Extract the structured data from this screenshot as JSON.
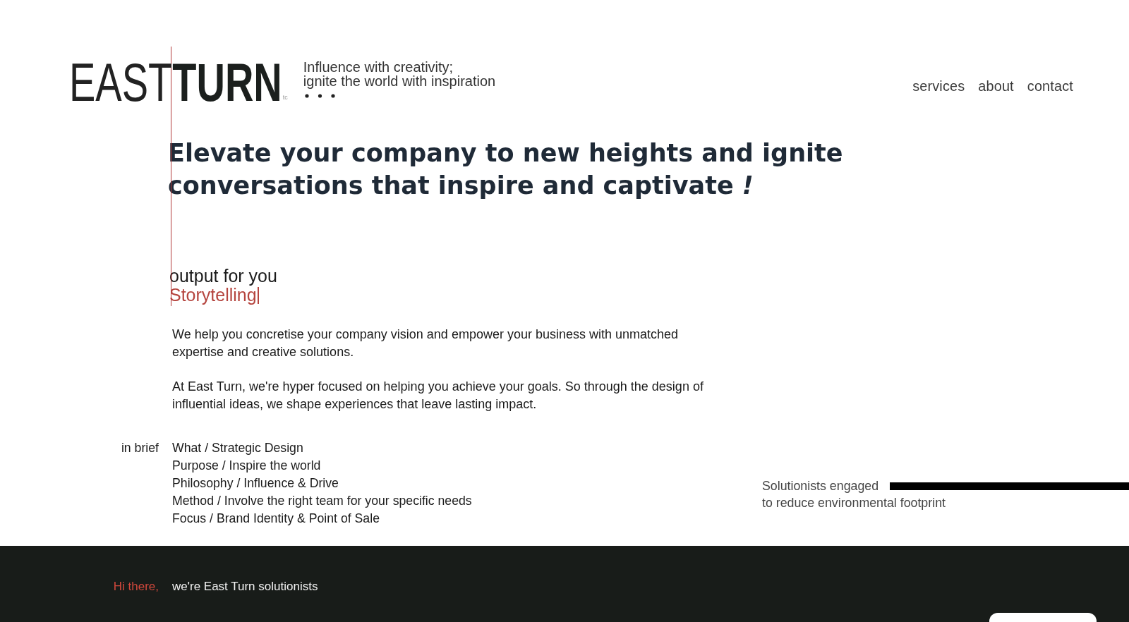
{
  "logo": {
    "light_word": "EAST",
    "bold_word": "TURN",
    "suffix": "tc"
  },
  "tagline": [
    "Influence with creativity;",
    "ignite the world with inspiration"
  ],
  "nav": [
    {
      "label": "services"
    },
    {
      "label": "about"
    },
    {
      "label": "contact"
    }
  ],
  "headline": "Elevate your company to new heights and ignite conversations that inspire and captivate *!*",
  "output": {
    "label": "output for you",
    "typed_word": "Storytelling"
  },
  "paragraphs": [
    "We help you concretise your company vision and empower your business with unmatched expertise and creative solutions.",
    "At East Turn, we're hyper focused on helping you achieve your goals. So through the design of influential ideas, we shape experiences that leave lasting impact."
  ],
  "brief": {
    "label": "in brief",
    "items": [
      "What / Strategic Design",
      "Purpose / Inspire the world",
      "Philosophy / Influence & Drive",
      "Method / Involve the right team for your specific needs",
      "Focus / Brand Identity & Point of Sale"
    ]
  },
  "engagement": [
    "Solutionists engaged",
    "to reduce environmental footprint"
  ],
  "footer": {
    "greeting": "Hi there,",
    "intro": "we're East Turn solutionists"
  }
}
